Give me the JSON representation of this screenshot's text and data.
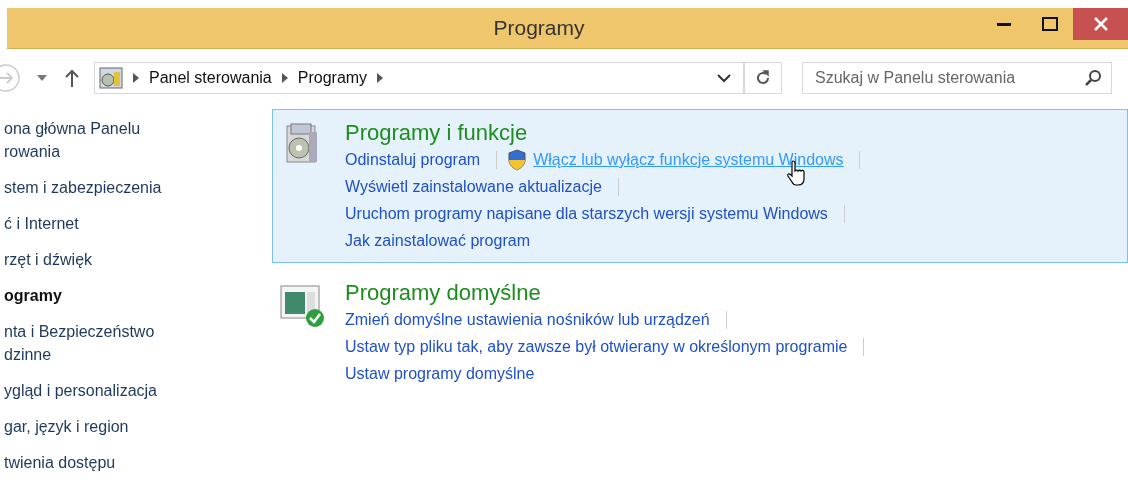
{
  "window": {
    "title": "Programy"
  },
  "address_bar": {
    "breadcrumbs": [
      "Panel sterowania",
      "Programy"
    ]
  },
  "search": {
    "placeholder": "Szukaj w Panelu sterowania"
  },
  "sidebar": {
    "items": [
      {
        "label": "ona główna Panelu\nrowania",
        "selected": false
      },
      {
        "label": "stem i zabezpieczenia",
        "selected": false
      },
      {
        "label": "ć i Internet",
        "selected": false
      },
      {
        "label": "rzęt i dźwięk",
        "selected": false
      },
      {
        "label": "ogramy",
        "selected": true
      },
      {
        "label": "nta i Bezpieczeństwo\ndzinne",
        "selected": false
      },
      {
        "label": "ygląd i personalizacja",
        "selected": false
      },
      {
        "label": "gar, język i region",
        "selected": false
      },
      {
        "label": "twienia dostępu",
        "selected": false
      }
    ]
  },
  "sections": [
    {
      "title": "Programy i funkcje",
      "kind": "installer",
      "highlighted": true,
      "rows": [
        [
          {
            "label": "Odinstaluj program",
            "shield": false,
            "hovered": false
          },
          {
            "label": "Włącz lub wyłącz funkcje systemu Windows",
            "shield": true,
            "hovered": true
          }
        ],
        [
          {
            "label": "Wyświetl zainstalowane aktualizacje",
            "shield": false,
            "hovered": false
          }
        ],
        [
          {
            "label": "Uruchom programy napisane dla starszych wersji systemu Windows",
            "shield": false,
            "hovered": false
          }
        ],
        [
          {
            "label": "Jak zainstalować program",
            "shield": false,
            "hovered": false
          }
        ]
      ]
    },
    {
      "title": "Programy domyślne",
      "kind": "defaults",
      "highlighted": false,
      "rows": [
        [
          {
            "label": "Zmień domyślne ustawienia nośników lub urządzeń",
            "shield": false,
            "hovered": false
          }
        ],
        [
          {
            "label": "Ustaw typ pliku tak, aby zawsze był otwierany w określonym programie",
            "shield": false,
            "hovered": false
          }
        ],
        [
          {
            "label": "Ustaw programy domyślne",
            "shield": false,
            "hovered": false
          }
        ]
      ]
    }
  ]
}
